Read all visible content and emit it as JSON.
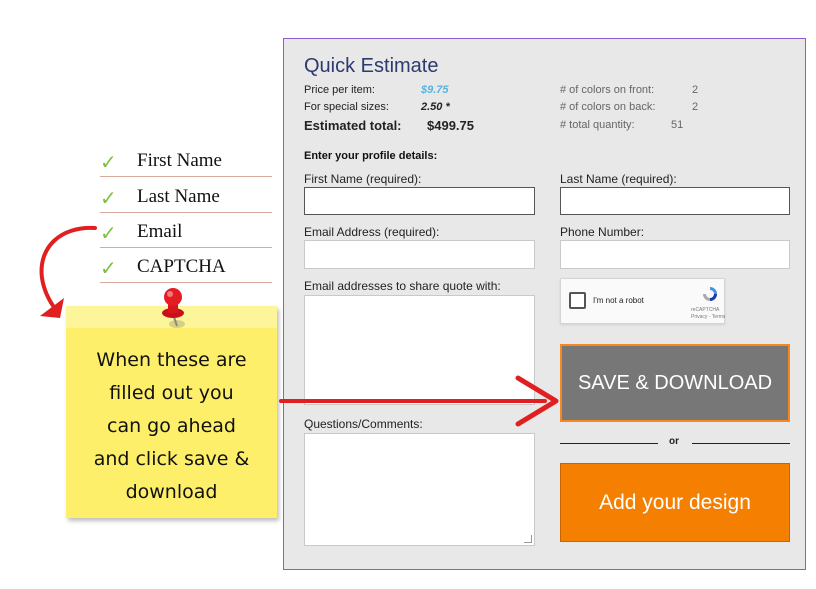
{
  "checklist": {
    "items": [
      {
        "label": "First Name",
        "icon": "checkmark-icon"
      },
      {
        "label": "Last Name",
        "icon": "checkmark-icon"
      },
      {
        "label": "Email",
        "icon": "checkmark-icon"
      },
      {
        "label": "CAPTCHA",
        "icon": "checkmark-icon"
      }
    ],
    "check_color": "#7cc242"
  },
  "note": {
    "text_lines": [
      "When these are",
      "filled out you",
      "can go ahead",
      "and click save &",
      "download"
    ],
    "color": "#fdef6a"
  },
  "estimate": {
    "title": "Quick Estimate",
    "price_label": "Price per item:",
    "price_value": "$9.75",
    "special_label": "For special sizes:",
    "special_value": "2.50 *",
    "total_label": "Estimated total:",
    "total_value": "$499.75",
    "front_label": "# of colors on front:",
    "front_value": "2",
    "back_label": "# of colors on back:",
    "back_value": "2",
    "quantity_label": "# total quantity:",
    "quantity_value": "51"
  },
  "form": {
    "section_label": "Enter your profile details:",
    "first_name_label": "First Name (required):",
    "last_name_label": "Last Name (required):",
    "email_label": "Email Address (required):",
    "phone_label": "Phone Number:",
    "share_label": "Email addresses to share quote with:",
    "comments_label": "Questions/Comments:",
    "first_name_value": "",
    "last_name_value": "",
    "email_value": "",
    "phone_value": "",
    "share_value": "",
    "comments_value": ""
  },
  "captcha": {
    "label": "I'm not a robot",
    "brand": "reCAPTCHA",
    "terms": "Privacy - Terms"
  },
  "buttons": {
    "save": "SAVE & DOWNLOAD",
    "or": "or",
    "design": "Add your design"
  },
  "colors": {
    "accent_orange": "#f57f00",
    "save_gray": "#777777",
    "panel_border": "#8e5bd1",
    "price_blue": "#57b4e0",
    "arrow_red": "#e02020"
  }
}
